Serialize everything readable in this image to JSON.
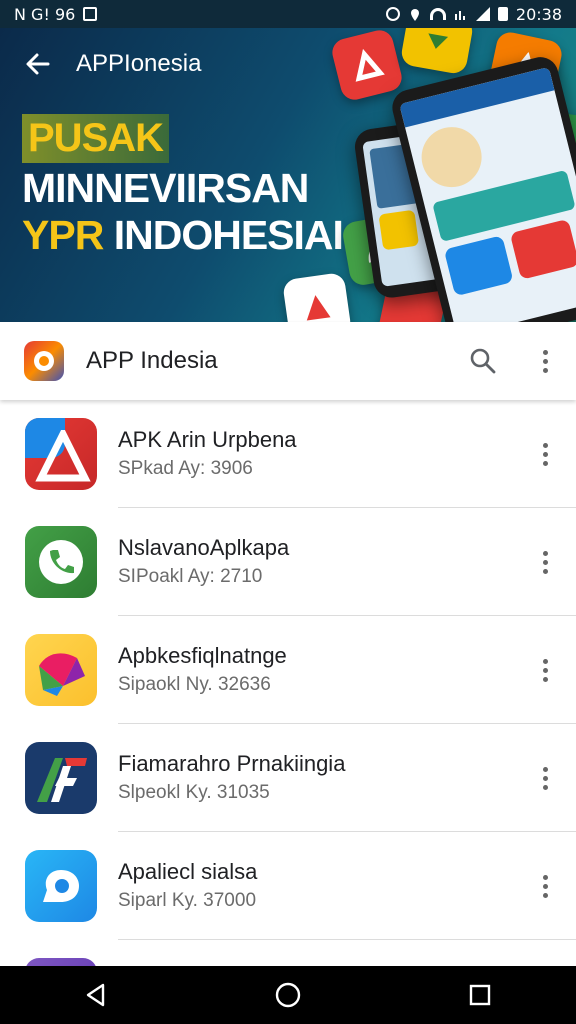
{
  "status_bar": {
    "left_text": "N G! 96",
    "time": "20:38"
  },
  "toolbar": {
    "title": "APPIonesia",
    "back_icon": "arrow-left-icon"
  },
  "banner": {
    "line1": "PUSAK",
    "line2": "MINNEVIIRSAN",
    "line3_accent": "YPR",
    "line3_rest": "INDOHESIAI",
    "colors": {
      "accent": "#f5c518",
      "bg_start": "#0b2a4a",
      "bg_end": "#1d8e7a"
    }
  },
  "app_header": {
    "title": "APP Indesia",
    "search_icon": "search-icon",
    "more_icon": "more-vert-icon"
  },
  "apps": [
    {
      "title": "APK Arin Urpbena",
      "subtitle": "SPkad Ay: 3906",
      "icon": "red-warning-icon"
    },
    {
      "title": "NslavanoAplkapa",
      "subtitle": "SIPoakl Ay: 2710",
      "icon": "phone-icon"
    },
    {
      "title": "Apbkesfiqlnatnge",
      "subtitle": "Sipaokl Ny. 32636",
      "icon": "rainbow-bird-icon"
    },
    {
      "title": "Fiamarahro Prnakiingia",
      "subtitle": "Slpeokl Ky. 31035",
      "icon": "af-logo-icon"
    },
    {
      "title": "Apaliecl sialsa",
      "subtitle": "Siparl Ky. 37000",
      "icon": "chat-bubble-icon"
    }
  ],
  "nav": {
    "back": "nav-back-icon",
    "home": "nav-home-icon",
    "recents": "nav-recents-icon"
  }
}
